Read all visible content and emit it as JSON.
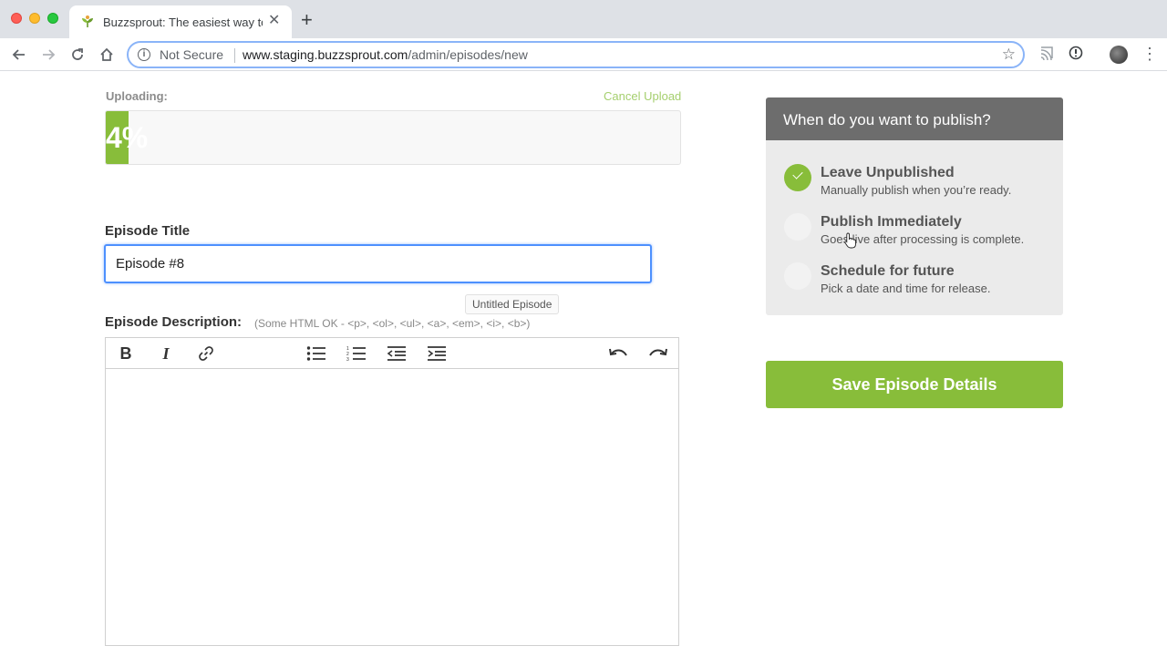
{
  "browser": {
    "tab_title": "Buzzsprout: The easiest way to",
    "new_tab": "+",
    "close": "✕",
    "security_label": "Not Secure",
    "url_host": "www.staging.buzzsprout.com",
    "url_path": "/admin/episodes/new"
  },
  "upload": {
    "label": "Uploading:",
    "cancel_label": "Cancel Upload",
    "progress_text": "4%",
    "progress_fraction": 0.04
  },
  "episode": {
    "title_label": "Episode Title",
    "title_value": "Episode #8",
    "title_tooltip": "Untitled Episode",
    "description_label": "Episode Description:",
    "description_hint": "(Some HTML OK - <p>, <ol>, <ul>, <a>, <em>, <i>, <b>)",
    "description_value": ""
  },
  "editor_toolbar": {
    "bold": "B",
    "italic": "I"
  },
  "publish": {
    "header": "When do you want to publish?",
    "options": [
      {
        "title": "Leave Unpublished",
        "subtitle": "Manually publish when you’re ready."
      },
      {
        "title": "Publish Immediately",
        "subtitle": "Goes live after processing is complete."
      },
      {
        "title": "Schedule for future",
        "subtitle": "Pick a date and time for release."
      }
    ],
    "selected": "Leave Unpublished"
  },
  "save_button": "Save Episode Details",
  "colors": {
    "brand_green": "#88bd3a",
    "focus_blue": "#4d90fe",
    "panel_header": "#6d6d6d"
  }
}
